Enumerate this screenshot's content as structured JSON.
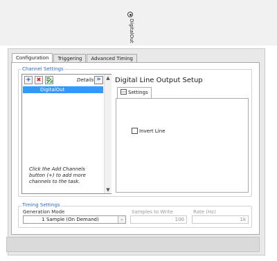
{
  "terminal": {
    "label": "DigitalOut"
  },
  "tabs": [
    {
      "label": "Configuration",
      "active": true
    },
    {
      "label": "Triggering",
      "active": false
    },
    {
      "label": "Advanced Timing",
      "active": false
    }
  ],
  "channel_settings": {
    "title": "Channel Settings",
    "details_label": "Details",
    "details_button": "»",
    "add_button": "+",
    "remove_button": "✖",
    "channels": [
      "DigitalOut"
    ],
    "hint": "Click the Add Channels button (+) to add more channels to the task."
  },
  "setup": {
    "title": "Digital Line Output Setup",
    "subtab_label": "Settings",
    "invert_line_label": "Invert Line",
    "invert_line_checked": false
  },
  "timing": {
    "title": "Timing Settings",
    "generation_mode_label": "Generation Mode",
    "generation_mode_value": "1 Sample (On Demand)",
    "samples_label": "Samples to Write",
    "samples_value": "100",
    "rate_label": "Rate (Hz)",
    "rate_value": "1k"
  },
  "colors": {
    "selection": "#3399ff",
    "group_title": "#2b6ac8",
    "details_arrow": "#1d4bb8"
  }
}
